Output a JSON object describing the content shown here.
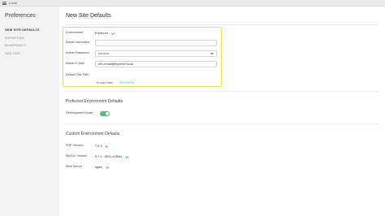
{
  "window": {
    "app_title": "Local"
  },
  "sidebar": {
    "title": "Preferences",
    "items": [
      {
        "label": "NEW SITE DEFAULTS",
        "active": true
      },
      {
        "label": "EXPORTING",
        "active": false
      },
      {
        "label": "BLUEPRINTS",
        "active": false
      },
      {
        "label": "ADD-ONS",
        "active": false
      }
    ]
  },
  "main": {
    "title": "New Site Defaults",
    "environment": {
      "label": "Environment",
      "value": "Preferred"
    },
    "admin_username": {
      "label": "Admin Username",
      "value": ""
    },
    "admin_password": {
      "label": "Admin Password",
      "value": "••••••••••"
    },
    "admin_email": {
      "label": "Admin E-Mail",
      "value": "dev-email@flywheel.local"
    },
    "site_path": {
      "label": "Default Site Path",
      "value": "~/Local Sites",
      "browse": "BROWSE"
    },
    "preferred_env": {
      "title": "Preferred Environment Defaults",
      "dev_mode_label": "Development Mode"
    },
    "custom_env": {
      "title": "Custom Environment Defaults",
      "php_label": "PHP Version",
      "php_value": "7.0.3",
      "mysql_label": "MySQL Version",
      "mysql_value": "5.7.1 - 50% of Sites",
      "web_label": "Web Server",
      "web_value": "nginx"
    }
  },
  "colors": {
    "accent": "#51bb7b",
    "highlight": "#f2e04a"
  }
}
